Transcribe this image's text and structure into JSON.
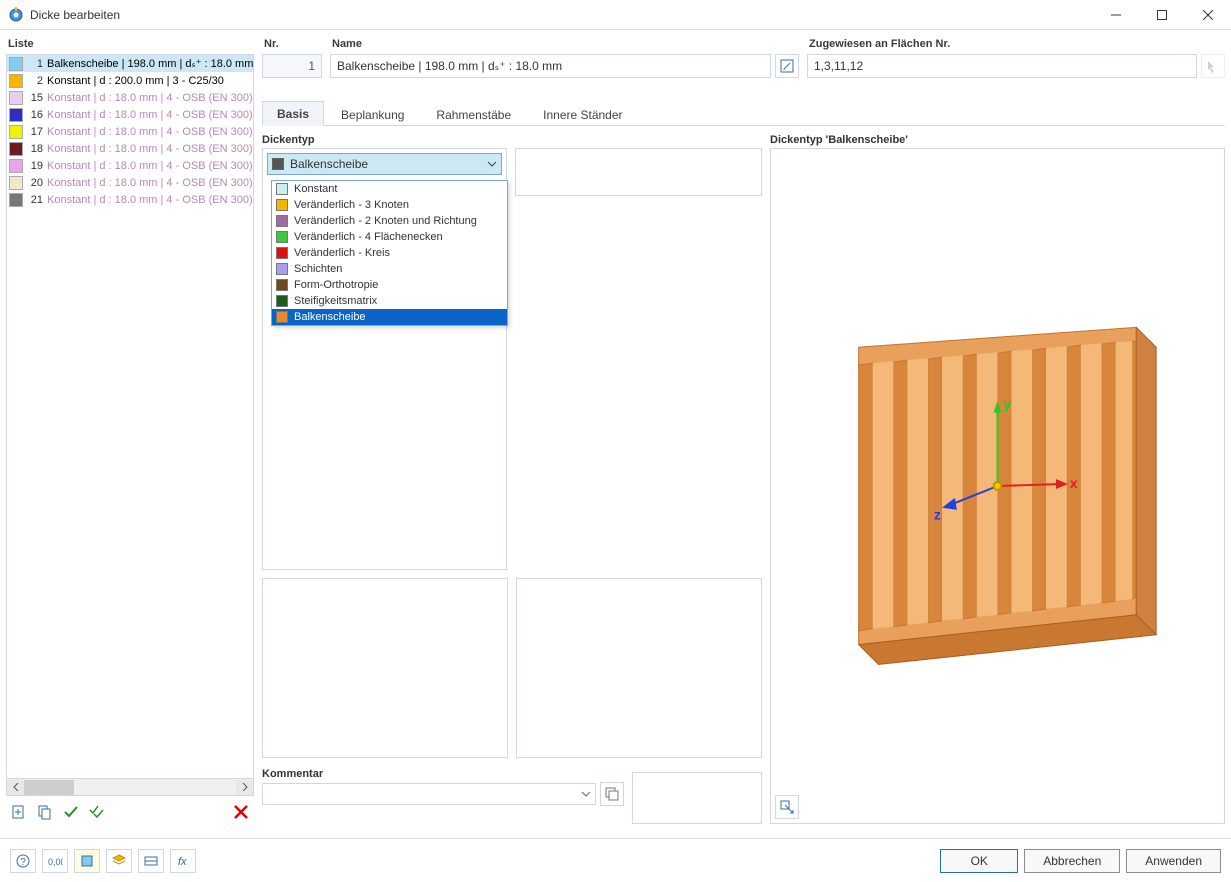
{
  "window": {
    "title": "Dicke bearbeiten"
  },
  "left": {
    "header": "Liste",
    "items": [
      {
        "num": "1",
        "color": "#81caf0",
        "label": "Balkenscheibe | 198.0 mm | dₛ⁺ : 18.0 mm",
        "selected": true
      },
      {
        "num": "2",
        "color": "#f6b600",
        "label": "Konstant | d : 200.0 mm | 3 - C25/30"
      },
      {
        "num": "15",
        "color": "#eacdef",
        "label": "Konstant | d : 18.0 mm | 4 - OSB (EN 300),"
      },
      {
        "num": "16",
        "color": "#2f2fbf",
        "label": "Konstant | d : 18.0 mm | 4 - OSB (EN 300),"
      },
      {
        "num": "17",
        "color": "#f2f200",
        "label": "Konstant | d : 18.0 mm | 4 - OSB (EN 300),"
      },
      {
        "num": "18",
        "color": "#6a1b1b",
        "label": "Konstant | d : 18.0 mm | 4 - OSB (EN 300),"
      },
      {
        "num": "19",
        "color": "#e7a6e7",
        "label": "Konstant | d : 18.0 mm | 4 - OSB (EN 300),"
      },
      {
        "num": "20",
        "color": "#f5e8c8",
        "label": "Konstant | d : 18.0 mm | 4 - OSB (EN 300),"
      },
      {
        "num": "21",
        "color": "#777777",
        "label": "Konstant | d : 18.0 mm | 4 - OSB (EN 300),"
      }
    ]
  },
  "header": {
    "nr_label": "Nr.",
    "nr_value": "1",
    "name_label": "Name",
    "name_value": "Balkenscheibe | 198.0 mm | dₛ⁺ : 18.0 mm",
    "assigned_label": "Zugewiesen an Flächen Nr.",
    "assigned_value": "1,3,11,12"
  },
  "tabs": [
    {
      "label": "Basis",
      "active": true
    },
    {
      "label": "Beplankung"
    },
    {
      "label": "Rahmenstäbe"
    },
    {
      "label": "Innere Ständer"
    }
  ],
  "dickentyp": {
    "label": "Dickentyp",
    "selected": "Balkenscheibe",
    "selected_color": "#555555",
    "options": [
      {
        "color": "#c8f0f0",
        "label": "Konstant"
      },
      {
        "color": "#f6b600",
        "label": "Veränderlich - 3 Knoten"
      },
      {
        "color": "#a06ba0",
        "label": "Veränderlich - 2 Knoten und Richtung"
      },
      {
        "color": "#3ec83e",
        "label": "Veränderlich - 4 Flächenecken"
      },
      {
        "color": "#e01010",
        "label": "Veränderlich - Kreis"
      },
      {
        "color": "#a7a0f0",
        "label": "Schichten"
      },
      {
        "color": "#6b4b1b",
        "label": "Form-Orthotropie"
      },
      {
        "color": "#1b5e1b",
        "label": "Steifigkeitsmatrix"
      },
      {
        "color": "#e88a2a",
        "label": "Balkenscheibe",
        "highlight": true
      }
    ]
  },
  "kommentar": {
    "label": "Kommentar"
  },
  "preview": {
    "label": "Dickentyp  'Balkenscheibe'",
    "axes": {
      "x": "x",
      "y": "y",
      "z": "z"
    }
  },
  "footer": {
    "ok": "OK",
    "cancel": "Abbrechen",
    "apply": "Anwenden"
  }
}
